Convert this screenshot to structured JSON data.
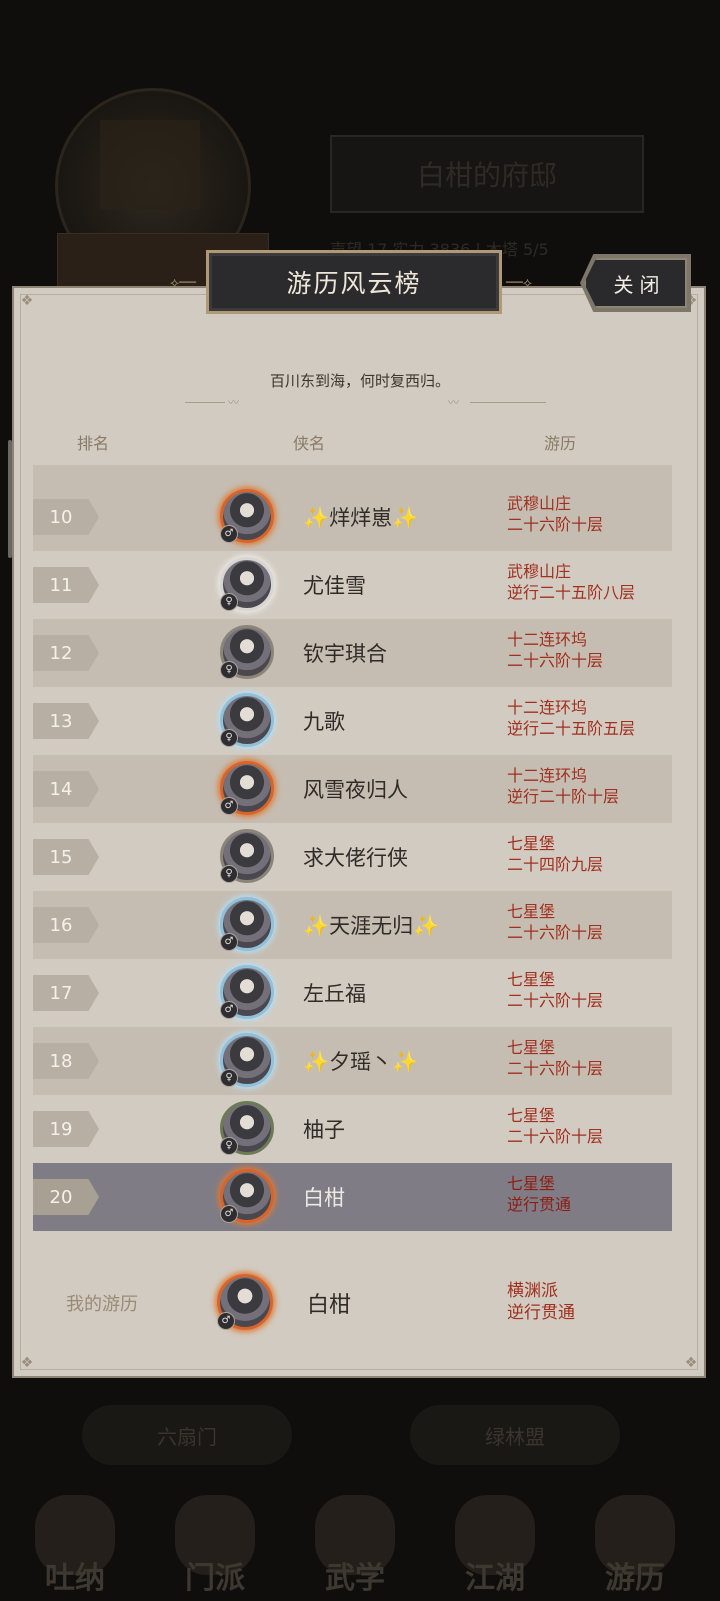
{
  "background": {
    "title": "白柑的府邸",
    "stats": "声望 17 实力 3836 | 木塔 5/5",
    "bottom_buttons": [
      "六扇门",
      "绿林盟"
    ],
    "nav": [
      "吐纳",
      "门派",
      "武学",
      "江湖",
      "游历"
    ]
  },
  "modal": {
    "title": "游历风云榜",
    "close_label": "关闭",
    "subtitle": "百川东到海，何时复西归。",
    "headers": {
      "rank": "排名",
      "name": "侠名",
      "travel": "游历"
    }
  },
  "rows": [
    {
      "rank": "10",
      "name": "✨烊烊崽✨",
      "place": "武穆山庄",
      "level": "二十六阶十层",
      "frame": "fire",
      "gender": "♂"
    },
    {
      "rank": "11",
      "name": "尤佳雪",
      "place": "武穆山庄",
      "level": "逆行二十五阶八层",
      "frame": "cloud",
      "gender": "♀"
    },
    {
      "rank": "12",
      "name": "钦宇琪合",
      "place": "十二连环坞",
      "level": "二十六阶十层",
      "frame": "plain",
      "gender": "♀"
    },
    {
      "rank": "13",
      "name": "九歌",
      "place": "十二连环坞",
      "level": "逆行二十五阶五层",
      "frame": "ice",
      "gender": "♀"
    },
    {
      "rank": "14",
      "name": "风雪夜归人",
      "place": "十二连环坞",
      "level": "逆行二十阶十层",
      "frame": "fire",
      "gender": "♂"
    },
    {
      "rank": "15",
      "name": "求大佬行侠",
      "place": "七星堡",
      "level": "二十四阶九层",
      "frame": "plain",
      "gender": "♀"
    },
    {
      "rank": "16",
      "name": "✨天涯无归✨",
      "place": "七星堡",
      "level": "二十六阶十层",
      "frame": "ice",
      "gender": "♂"
    },
    {
      "rank": "17",
      "name": "左丘福",
      "place": "七星堡",
      "level": "二十六阶十层",
      "frame": "ice",
      "gender": "♂"
    },
    {
      "rank": "18",
      "name": "✨夕瑶丶✨",
      "place": "七星堡",
      "level": "二十六阶十层",
      "frame": "ice",
      "gender": "♀"
    },
    {
      "rank": "19",
      "name": "柚子",
      "place": "七星堡",
      "level": "二十六阶十层",
      "frame": "leaf",
      "gender": "♀"
    },
    {
      "rank": "20",
      "name": "白柑",
      "place": "七星堡",
      "level": "逆行贯通",
      "frame": "fire",
      "gender": "♂",
      "mine": true
    }
  ],
  "mine": {
    "label": "我的游历",
    "name": "白柑",
    "place": "横渊派",
    "level": "逆行贯通",
    "gender": "♂"
  }
}
